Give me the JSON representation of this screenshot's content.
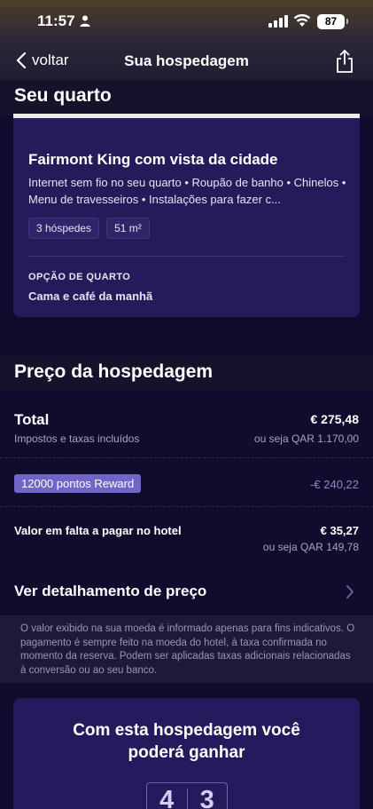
{
  "status_bar": {
    "time": "11:57",
    "battery": "87"
  },
  "nav": {
    "back_label": "voltar",
    "title": "Sua hospedagem"
  },
  "room_section": {
    "title": "Seu quarto",
    "room_name": "Fairmont King com vista da cidade",
    "amenities": "Internet sem fio no seu quarto • Roupão de banho • Chinelos • Menu de travesseiros • Instalações para fazer c...",
    "chips": [
      "3 hóspedes",
      "51 m²"
    ],
    "option_label": "OPÇÃO DE QUARTO",
    "option_value": "Cama e café da manhã"
  },
  "price_section": {
    "title": "Preço da hospedagem",
    "total_label": "Total",
    "total_sub": "Impostos e taxas incluídos",
    "total_value": "€ 275,48",
    "total_alt": "ou seja QAR 1.170,00",
    "reward_badge": "12000 pontos Reward",
    "reward_value": "-€ 240,22",
    "remaining_label": "Valor em falta a pagar no hotel",
    "remaining_value": "€ 35,27",
    "remaining_alt": "ou seja QAR 149,78",
    "breakdown_link": "Ver detalhamento de preço",
    "disclaimer": "O valor exibido na sua moeda é informado apenas para fins indicativos. O pagamento é sempre feito na moeda do hotel, à taxa confirmada no momento da reserva. Podem ser aplicadas taxas adicionais relacionadas à conversão ou ao seu banco."
  },
  "earn_section": {
    "title": "Com esta hospedagem você poderá ganhar",
    "digits": [
      "4",
      "3"
    ]
  },
  "colors": {
    "background": "#100c2e",
    "card": "#231b5a",
    "reward_badge": "#6f66c8",
    "reward_value": "#8c88b8"
  },
  "icons": [
    "chevron-left-icon",
    "share-icon",
    "chevron-right-icon",
    "person-icon",
    "signal-icon",
    "wifi-icon"
  ]
}
